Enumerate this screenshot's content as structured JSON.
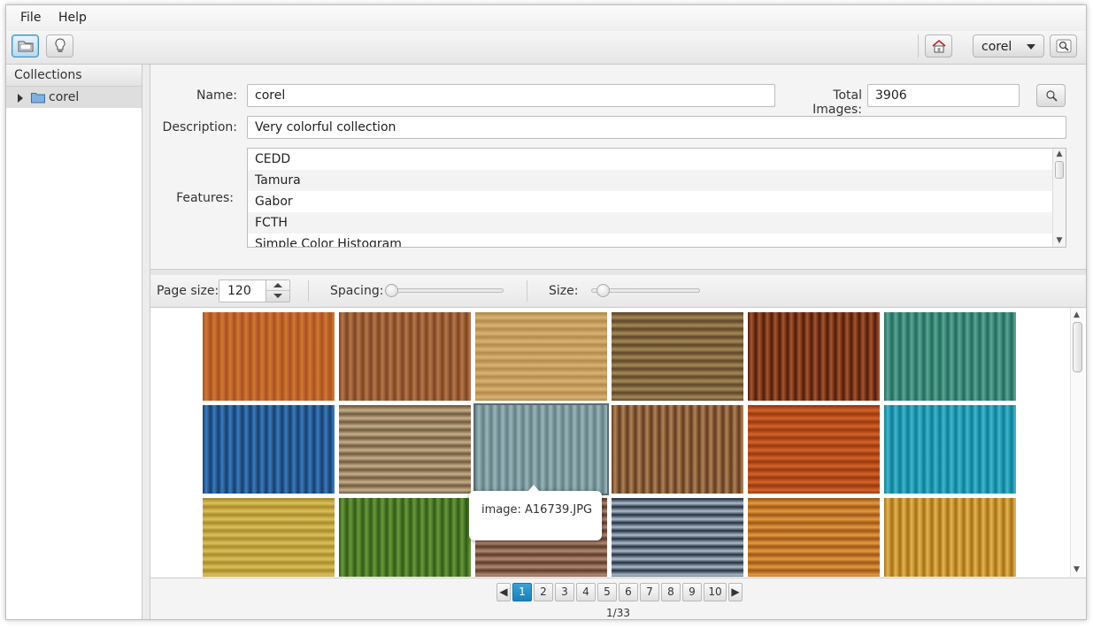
{
  "menu": {
    "file": "File",
    "help": "Help"
  },
  "toolbar": {
    "collection_combo": "corel"
  },
  "sidebar": {
    "header": "Collections",
    "items": [
      {
        "label": "corel"
      }
    ]
  },
  "form": {
    "name_label": "Name:",
    "name_value": "corel",
    "total_label": "Total Images:",
    "total_value": "3906",
    "description_label": "Description:",
    "description_value": "Very colorful collection",
    "features_label": "Features:",
    "features": [
      "CEDD",
      "Tamura",
      "Gabor",
      "FCTH",
      "Simple Color Histogram"
    ]
  },
  "grid_controls": {
    "page_size_label": "Page size:",
    "page_size_value": "120",
    "spacing_label": "Spacing:",
    "spacing_level": 0,
    "size_label": "Size:",
    "size_level": 0
  },
  "thumbnails": [
    {
      "tile": "orange wood planks",
      "c1": "#a9501d",
      "c2": "#d07a35"
    },
    {
      "tile": "brown corrugated",
      "c1": "#7b4322",
      "c2": "#b8784a"
    },
    {
      "tile": "golden stripes",
      "c1": "#b48a4a",
      "c2": "#d9b474"
    },
    {
      "tile": "wooden slats",
      "c1": "#5d4628",
      "c2": "#a68a57"
    },
    {
      "tile": "dark red vertical wood",
      "c1": "#4d1a0d",
      "c2": "#a8562c"
    },
    {
      "tile": "teal metal",
      "c1": "#1c6a60",
      "c2": "#5fa692"
    },
    {
      "tile": "blue corrugated",
      "c1": "#143d6e",
      "c2": "#3b7cc0"
    },
    {
      "tile": "rebar rods",
      "c1": "#6e5940",
      "c2": "#c9b08a"
    },
    {
      "tile": "blue-grey wood",
      "c1": "#5f7f86",
      "c2": "#9cb6b8"
    },
    {
      "tile": "brown stakes",
      "c1": "#5d3a1f",
      "c2": "#b48356"
    },
    {
      "tile": "orange wood",
      "c1": "#99370f",
      "c2": "#d4652a"
    },
    {
      "tile": "cyan corrugated",
      "c1": "#0f7a92",
      "c2": "#3bb9d0"
    },
    {
      "tile": "yellow wicker",
      "c1": "#a88a2c",
      "c2": "#dcc25b"
    },
    {
      "tile": "green wood",
      "c1": "#2f5a16",
      "c2": "#6b9a3a"
    },
    {
      "tile": "brown pattern",
      "c1": "#5a3a2a",
      "c2": "#b58a74"
    },
    {
      "tile": "grey shutters",
      "c1": "#23303f",
      "c2": "#aebccb"
    },
    {
      "tile": "orange wicker",
      "c1": "#9e5516",
      "c2": "#e39b41"
    },
    {
      "tile": "bamboo",
      "c1": "#a66d11",
      "c2": "#e2b655"
    }
  ],
  "tooltip": {
    "text": "image: A16739.JPG"
  },
  "pagination": {
    "pages": [
      "1",
      "2",
      "3",
      "4",
      "5",
      "6",
      "7",
      "8",
      "9",
      "10"
    ],
    "current": "1",
    "count": "1/33"
  },
  "colors": {
    "accent": "#1a7fb7",
    "selection": "#3a92c8"
  }
}
